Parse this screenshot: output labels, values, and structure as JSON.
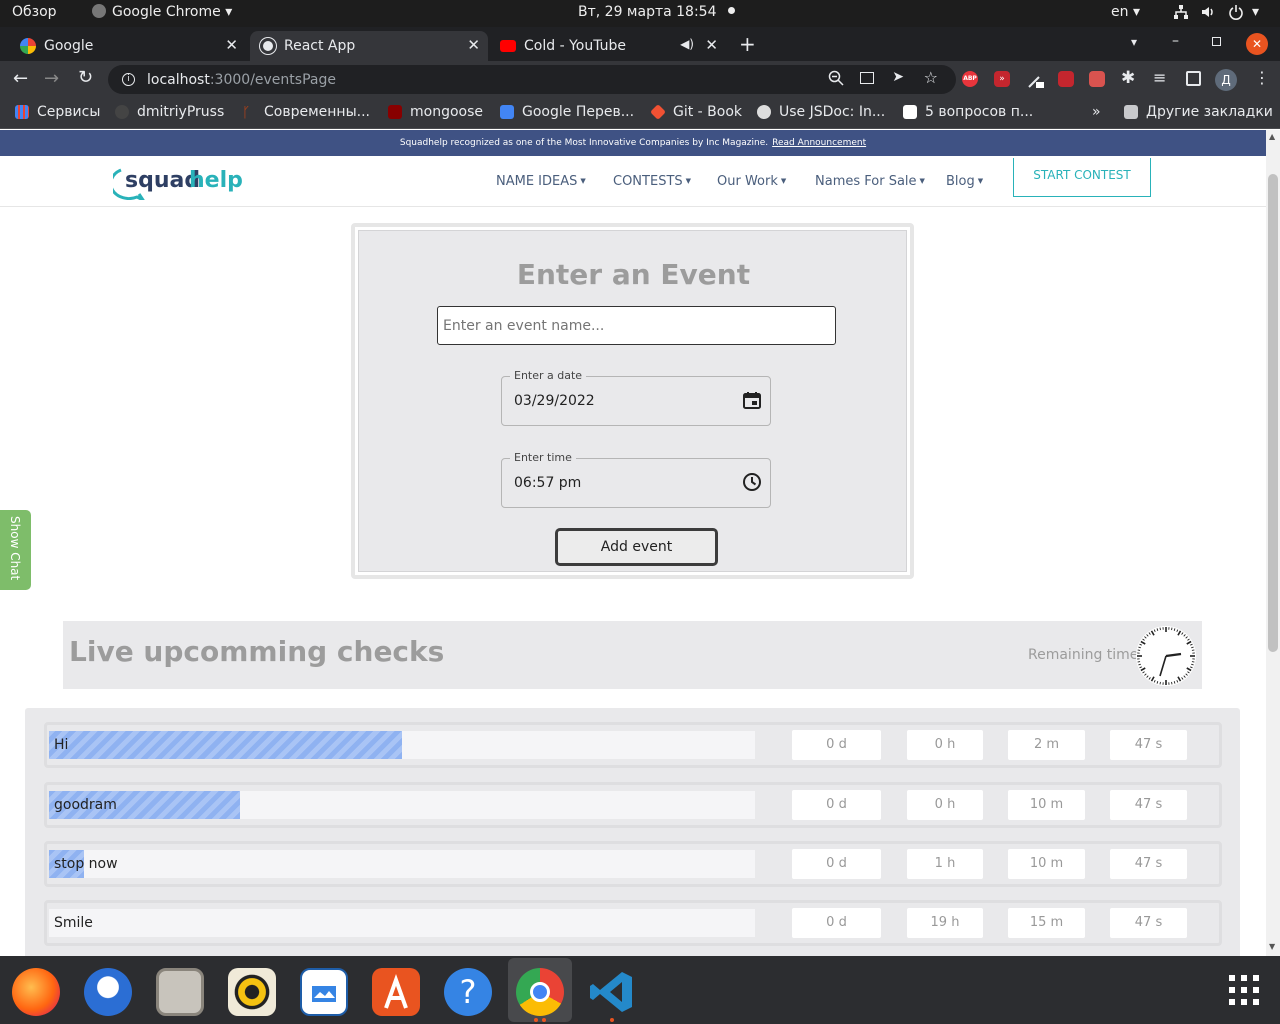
{
  "system_bar": {
    "activities": "Обзор",
    "app_name": "Google Chrome",
    "datetime": "Вт, 29 марта  18:54",
    "language": "en"
  },
  "tabs": [
    {
      "title": "Google",
      "icon": "google-icon"
    },
    {
      "title": "React App",
      "icon": "globe-icon"
    },
    {
      "title": "Cold - YouTube",
      "icon": "youtube-icon"
    }
  ],
  "address_bar": {
    "host": "localhost",
    "path": ":3000/eventsPage"
  },
  "extensions": {
    "abp_label": "ABP",
    "profile_initial": "Д"
  },
  "bookmarks": [
    "Сервисы",
    "dmitriyPruss",
    "Современны...",
    "mongoose",
    "Google Перев...",
    "Git - Book",
    "Use JSDoc: In...",
    "5 вопросов п..."
  ],
  "bookmarks_more": "»",
  "bookmarks_other": "Другие закладки",
  "page": {
    "banner": {
      "text": "Squadhelp recognized as one of the Most Innovative Companies by Inc Magazine.",
      "link": "Read Announcement"
    },
    "nav": {
      "logo_left": "squad",
      "logo_right": "help",
      "items": [
        "NAME IDEAS",
        "CONTESTS",
        "Our Work",
        "Names For Sale",
        "Blog"
      ],
      "cta": "START CONTEST"
    },
    "form": {
      "title": "Enter an Event",
      "event_placeholder": "Enter an event name...",
      "date_label": "Enter a date",
      "date_value": "03/29/2022",
      "time_label": "Enter time",
      "time_value": "06:57 pm",
      "submit": "Add event"
    },
    "live": {
      "title": "Live upcomming checks",
      "remaining_label": "Remaining time:"
    },
    "events": [
      {
        "name": "Hi",
        "progress": 0.5,
        "days": "0 d",
        "hours": "0 h",
        "minutes": "2 m",
        "seconds": "47 s"
      },
      {
        "name": "goodram",
        "progress": 0.27,
        "days": "0 d",
        "hours": "0 h",
        "minutes": "10 m",
        "seconds": "47 s"
      },
      {
        "name": "stop now",
        "progress": 0.05,
        "days": "0 d",
        "hours": "1 h",
        "minutes": "10 m",
        "seconds": "47 s"
      },
      {
        "name": "Smile",
        "progress": 0.0,
        "days": "0 d",
        "hours": "19 h",
        "minutes": "15 m",
        "seconds": "47 s"
      }
    ],
    "chat_toggle": "Show Chat"
  },
  "dock": [
    "firefox-icon",
    "thunderbird-icon",
    "files-icon",
    "rhythmbox-icon",
    "writer-icon",
    "software-icon",
    "help-icon",
    "chrome-icon",
    "vscode-icon",
    "apps-grid-icon"
  ],
  "colors": {
    "banner": "#3f5284",
    "accent": "#29b2b9",
    "progress": "#8fb2f1",
    "chat": "#7ebd6a"
  }
}
